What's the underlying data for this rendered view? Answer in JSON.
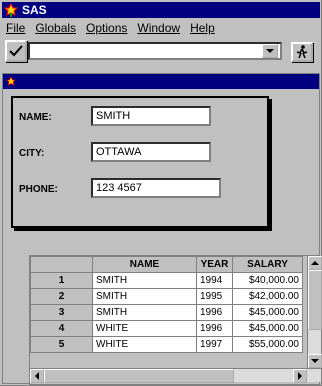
{
  "window": {
    "title": "SAS"
  },
  "menu": [
    {
      "label": "File"
    },
    {
      "label": "Globals"
    },
    {
      "label": "Options"
    },
    {
      "label": "Window"
    },
    {
      "label": "Help"
    }
  ],
  "form": {
    "name_label": "NAME:",
    "name_value": "SMITH",
    "city_label": "CITY:",
    "city_value": "OTTAWA",
    "phone_label": "PHONE:",
    "phone_value": "123 4567"
  },
  "table": {
    "headers": [
      "NAME",
      "YEAR",
      "SALARY"
    ],
    "rows": [
      {
        "id": "1",
        "name": "SMITH",
        "year": "1994",
        "salary": "$40,000.00"
      },
      {
        "id": "2",
        "name": "SMITH",
        "year": "1995",
        "salary": "$42,000.00"
      },
      {
        "id": "3",
        "name": "SMITH",
        "year": "1996",
        "salary": "$45,000.00"
      },
      {
        "id": "4",
        "name": "WHITE",
        "year": "1996",
        "salary": "$45,000.00"
      },
      {
        "id": "5",
        "name": "WHITE",
        "year": "1997",
        "salary": "$55,000.00"
      }
    ]
  },
  "icons": {
    "app_logo": "sas-logo-icon",
    "check": "check-icon",
    "dropdown": "chevron-down-icon",
    "run": "run-icon",
    "scroll_up": "arrow-up-icon",
    "scroll_down": "arrow-down-icon",
    "scroll_left": "arrow-left-icon",
    "scroll_right": "arrow-right-icon"
  }
}
